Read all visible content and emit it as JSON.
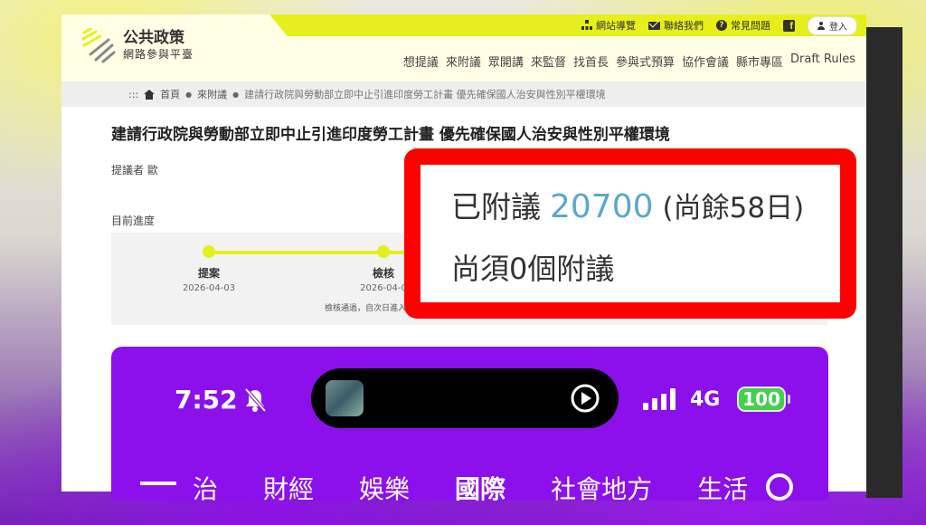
{
  "header": {
    "logo_title": "公共政策",
    "logo_subtitle": "網路參與平臺",
    "top_links": [
      {
        "label": "網站導覽",
        "icon": "sitemap-icon"
      },
      {
        "label": "聯絡我們",
        "icon": "mail-icon"
      },
      {
        "label": "常見問題",
        "icon": "help-icon"
      }
    ],
    "login_label": "登入",
    "nav": [
      "想提議",
      "來附議",
      "眾開講",
      "來監督",
      "找首長",
      "參與式預算",
      "協作會議",
      "縣市專區",
      "Draft Rules"
    ]
  },
  "breadcrumb": {
    "home": "首頁",
    "section": "來附議",
    "current": "建請行政院與勞動部立即中止引進印度勞工計畫 優先確保國人治安與性別平權環境"
  },
  "proposal": {
    "title": "建請行政院與勞動部立即中止引進印度勞工計畫 優先確保國人治安與性別平權環境",
    "proposer": "提議者 歐",
    "progress_label": "目前進度",
    "steps": [
      {
        "label": "提案",
        "date": "2026-04-03"
      },
      {
        "label": "檢核",
        "date": "2026-04-0"
      }
    ],
    "step_note": "檢核通過，自次日進入"
  },
  "callout": {
    "prefix": "已附議",
    "count": "20700",
    "remaining": "(尚餘58日)",
    "needed": "尚須0個附議"
  },
  "phone": {
    "time": "7:52",
    "network": "4G",
    "battery": "100",
    "nav": [
      "治",
      "財經",
      "娛樂",
      "國際",
      "社會地方",
      "生活"
    ]
  },
  "colors": {
    "accent_yellow": "#e6ef1c",
    "highlight_red": "#ff0000",
    "count_blue": "#5aa8cc",
    "phone_purple": "#8c10ec"
  }
}
